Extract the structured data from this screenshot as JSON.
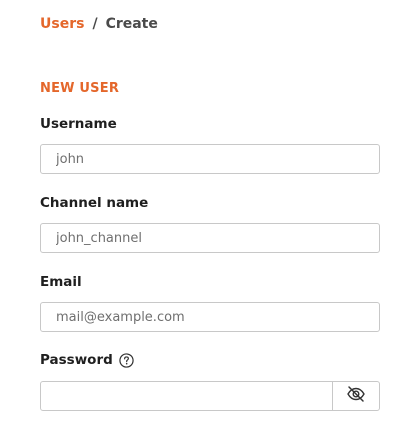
{
  "breadcrumb": {
    "parent": "Users",
    "separator": "/",
    "current": "Create"
  },
  "form": {
    "section_title": "NEW USER",
    "username": {
      "label": "Username",
      "placeholder": "john"
    },
    "channel_name": {
      "label": "Channel name",
      "placeholder": "john_channel"
    },
    "email": {
      "label": "Email",
      "placeholder": "mail@example.com"
    },
    "password": {
      "label": "Password",
      "value": ""
    }
  },
  "icons": {
    "help": "question-circle-icon",
    "toggle_visibility": "eye-off-icon"
  },
  "colors": {
    "accent": "#e4672b",
    "text": "#1f1f1f",
    "border": "#c8c8c8"
  }
}
